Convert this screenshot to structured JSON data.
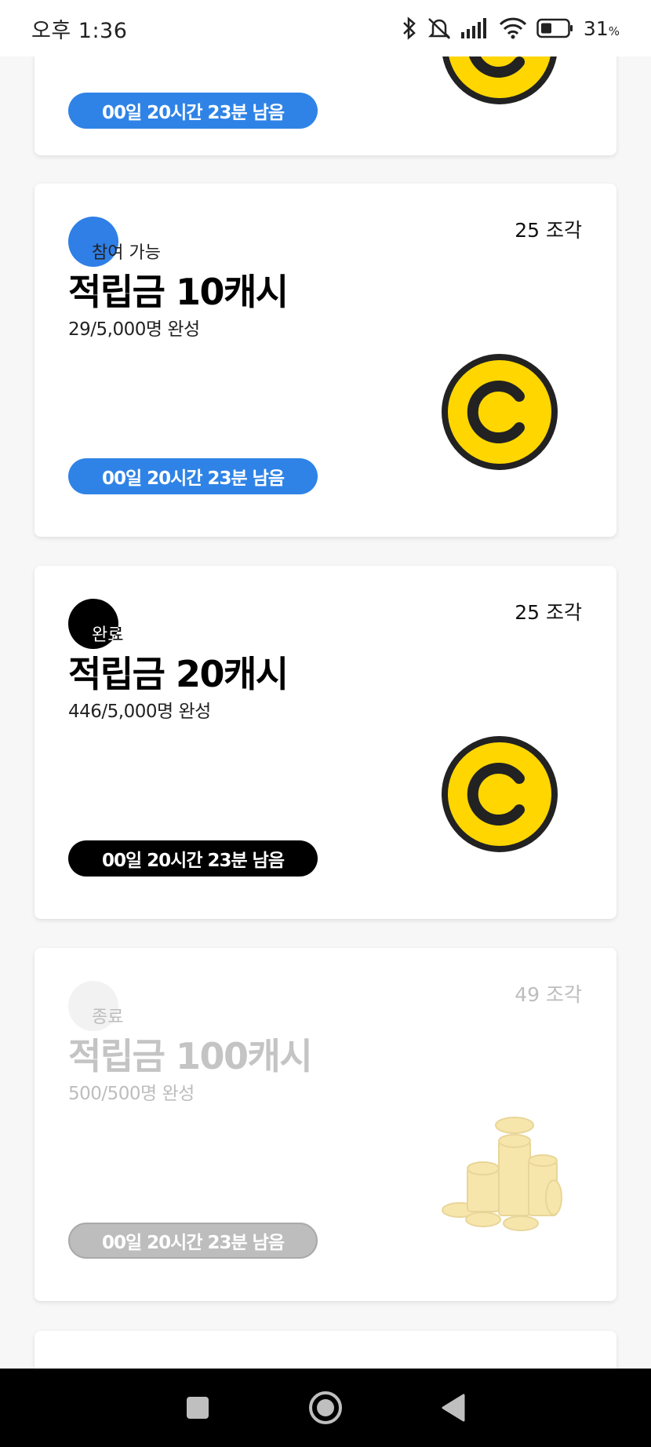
{
  "status_bar": {
    "time": "오후 1:36",
    "battery_percent": "31",
    "battery_unit": "%"
  },
  "cards": [
    {
      "status": "",
      "title": "",
      "progress": "",
      "pieces": "",
      "timer": "00일 20시간 23분 남음",
      "timer_color": "#2f83e6"
    },
    {
      "status": "참여 가능",
      "title": "적립금 10캐시",
      "progress": "29/5,000명 완성",
      "pieces": "25 조각",
      "timer": "00일 20시간 23분 남음",
      "dot_color": "#2f7fe6",
      "timer_color": "#2f83e6",
      "image": "coin-c-icon"
    },
    {
      "status": "완료",
      "title": "적립금 20캐시",
      "progress": "446/5,000명 완성",
      "pieces": "25 조각",
      "timer": "00일 20시간 23분 남음",
      "dot_color": "#000000",
      "timer_color": "#000000",
      "image": "coin-c-icon"
    },
    {
      "status": "종료",
      "title": "적립금 100캐시",
      "progress": "500/500명 완성",
      "pieces": "49 조각",
      "timer": "00일 20시간 23분 남음",
      "dot_color": "#f2f2f2",
      "timer_color": "#bdbdbd",
      "image": "coin-stack-icon"
    }
  ],
  "nav": {
    "recent": "square-icon",
    "home": "circle-home-icon",
    "back": "triangle-back-icon"
  }
}
